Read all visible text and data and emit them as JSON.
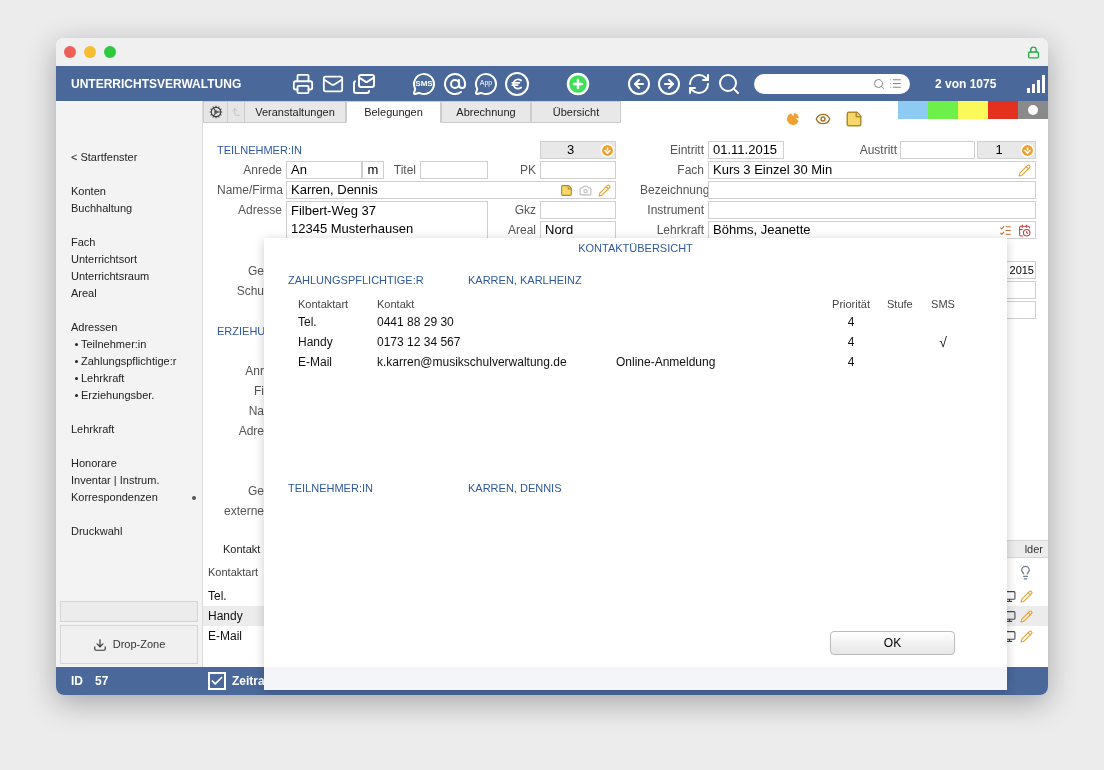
{
  "app_title": "UNTERRICHTSVERWALTUNG",
  "toolbar": {
    "sms_label": "SMS",
    "app_label": "App",
    "record_counter": "2 von 1075"
  },
  "tabs": [
    {
      "label": "Veranstaltungen",
      "selected": false
    },
    {
      "label": "Belegungen",
      "selected": true
    },
    {
      "label": "Abrechnung",
      "selected": false
    },
    {
      "label": "Übersicht",
      "selected": false
    }
  ],
  "color_tags": [
    {
      "color": "#8ecbf2",
      "selected": false
    },
    {
      "color": "#6ef04a",
      "selected": false
    },
    {
      "color": "#fbf95a",
      "selected": false
    },
    {
      "color": "#e3301f",
      "selected": false
    },
    {
      "color": "#8a8a8a",
      "selected": true
    }
  ],
  "sidebar": {
    "groups": [
      [
        {
          "label": "< Startfenster",
          "kind": "link",
          "dot": false
        }
      ],
      [
        {
          "label": "Konten",
          "kind": "link",
          "dot": false
        },
        {
          "label": "Buchhaltung",
          "kind": "link",
          "dot": false
        }
      ],
      [
        {
          "label": "Fach",
          "kind": "link",
          "dot": false
        },
        {
          "label": "Unterrichtsort",
          "kind": "link",
          "dot": false
        },
        {
          "label": "Unterrichtsraum",
          "kind": "link",
          "dot": false
        },
        {
          "label": "Areal",
          "kind": "link",
          "dot": false
        }
      ],
      [
        {
          "label": "Adressen",
          "kind": "link",
          "dot": false
        },
        {
          "label": "Teilnehmer:in",
          "kind": "sub",
          "dot": false
        },
        {
          "label": "Zahlungspflichtige:r",
          "kind": "sub",
          "dot": false
        },
        {
          "label": "Lehrkraft",
          "kind": "sub",
          "dot": false
        },
        {
          "label": "Erziehungsber.",
          "kind": "sub",
          "dot": false
        }
      ],
      [
        {
          "label": "Lehrkraft",
          "kind": "link",
          "dot": false
        }
      ],
      [
        {
          "label": "Honorare",
          "kind": "link",
          "dot": false
        },
        {
          "label": "Inventar | Instrum.",
          "kind": "link",
          "dot": false
        },
        {
          "label": "Korrespondenzen",
          "kind": "link",
          "dot": true
        }
      ],
      [
        {
          "label": "Druckwahl",
          "kind": "link",
          "dot": false
        }
      ]
    ],
    "drop_zone": "Drop-Zone"
  },
  "participant": {
    "section_title": "TEILNEHMER:IN",
    "counter": "3",
    "anrede_label": "Anrede",
    "anrede": "An",
    "gender": "m",
    "titel_label": "Titel",
    "pk_label": "PK",
    "name_label": "Name/Firma",
    "name": "Karren, Dennis",
    "adresse_label": "Adresse",
    "adresse_lines": [
      "Filbert-Weg 37",
      "12345 Musterhausen"
    ],
    "gkz_label": "Gkz",
    "areal_label": "Areal",
    "areal": "Nord"
  },
  "left_fragments": [
    {
      "kind": "gap"
    },
    {
      "kind": "label",
      "text": "Ge"
    },
    {
      "kind": "label",
      "text": "Schu"
    },
    {
      "kind": "gap"
    },
    {
      "kind": "section",
      "text": "ERZIEHU"
    },
    {
      "kind": "gap"
    },
    {
      "kind": "label",
      "text": "Anr"
    },
    {
      "kind": "label",
      "text": "Fi"
    },
    {
      "kind": "label",
      "text": "Na"
    },
    {
      "kind": "label",
      "text": "Adre"
    },
    {
      "kind": "gap"
    },
    {
      "kind": "gap"
    },
    {
      "kind": "label",
      "text": "Ge"
    },
    {
      "kind": "label",
      "text": "externe"
    }
  ],
  "booking": {
    "eintritt_label": "Eintritt",
    "eintritt": "01.11.2015",
    "austritt_label": "Austritt",
    "counter": "1",
    "fach_label": "Fach",
    "fach": "Kurs 3 Einzel 30 Min",
    "bezeichnung_label": "Bezeichnung",
    "instrument_label": "Instrument",
    "lehrkraft_label": "Lehrkraft",
    "lehrkraft": "Böhms, Jeanette"
  },
  "right_fragments": [
    {
      "kind": "gap"
    },
    {
      "kind": "field",
      "value": "2015"
    },
    {
      "kind": "field"
    },
    {
      "kind": "field"
    }
  ],
  "lower_tabs": {
    "left": "Kontakt",
    "right": "lder"
  },
  "lower_table": {
    "header": "Kontaktart",
    "rows": [
      {
        "label": "Tel.",
        "shaded": false
      },
      {
        "label": "Handy",
        "shaded": true
      },
      {
        "label": "E-Mail",
        "shaded": false
      }
    ]
  },
  "status_bar": {
    "id_label": "ID",
    "id": "57",
    "period_checked": true,
    "period_label": "Zeitra"
  },
  "modal": {
    "title": "KONTAKTÜBERSICHT",
    "sections": [
      {
        "role": "ZAHLUNGSPFLICHTIGE:R",
        "name": "KARREN, KARLHEINZ",
        "columns": [
          "Kontaktart",
          "Kontakt",
          "Priorität",
          "Stufe",
          "SMS"
        ],
        "rows": [
          {
            "type": "Tel.",
            "contact": "0441 88 29 30",
            "priority": "4",
            "sms": false
          },
          {
            "type": "Handy",
            "contact": "0173 12 34 567",
            "priority": "4",
            "sms": true
          },
          {
            "type": "E-Mail",
            "contact": "k.karren@musikschulverwaltung.de",
            "remark": "Online-Anmeldung",
            "priority": "4",
            "sms": false
          }
        ]
      },
      {
        "role": "TEILNEHMER:IN",
        "name": "KARREN, DENNIS"
      }
    ],
    "sms_mark": "√",
    "ok": "OK"
  }
}
